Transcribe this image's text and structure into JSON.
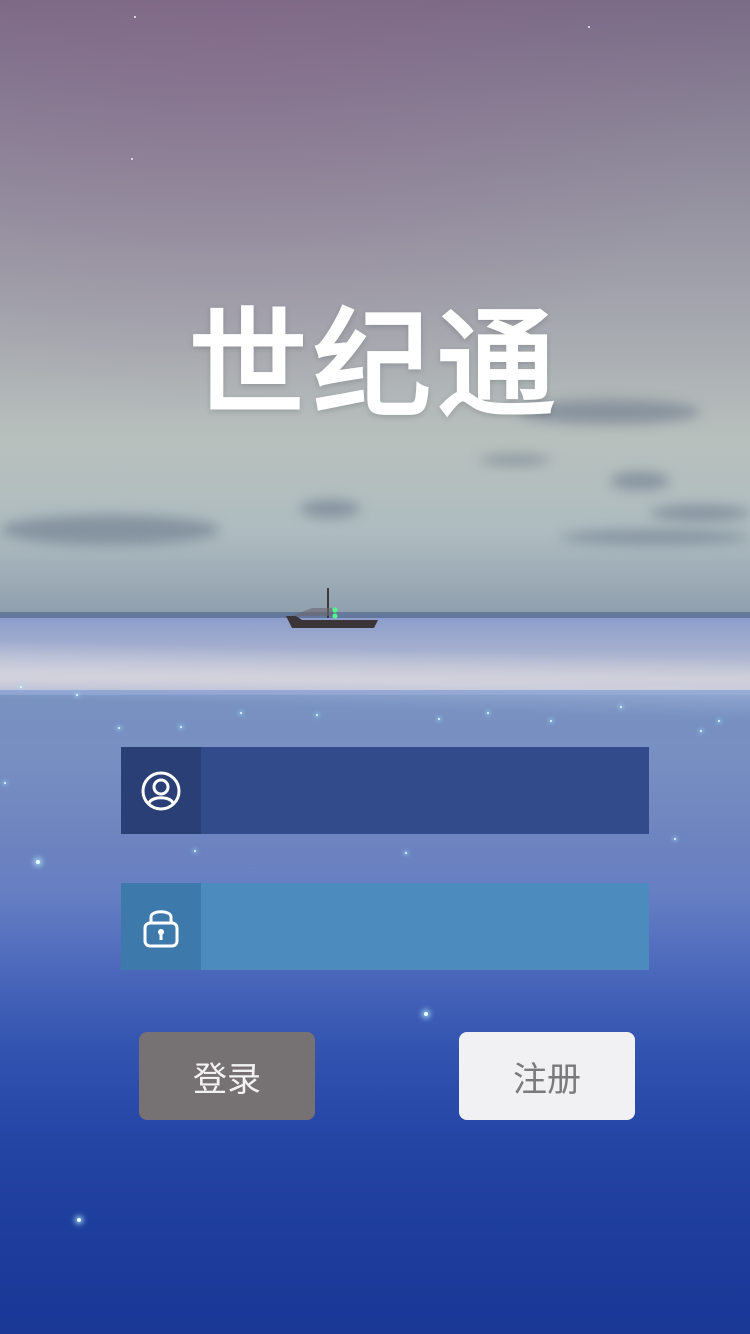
{
  "app": {
    "logo_text": "世纪通"
  },
  "login_form": {
    "username": {
      "icon": "user-icon",
      "value": "",
      "placeholder": ""
    },
    "password": {
      "icon": "lock-icon",
      "value": "",
      "placeholder": ""
    },
    "login_label": "登录",
    "register_label": "注册"
  },
  "colors": {
    "username_field_bg": "#324b8a",
    "password_field_bg": "#4b8bbd",
    "login_button_bg": "#767273",
    "register_button_bg": "#f1f0f3"
  }
}
